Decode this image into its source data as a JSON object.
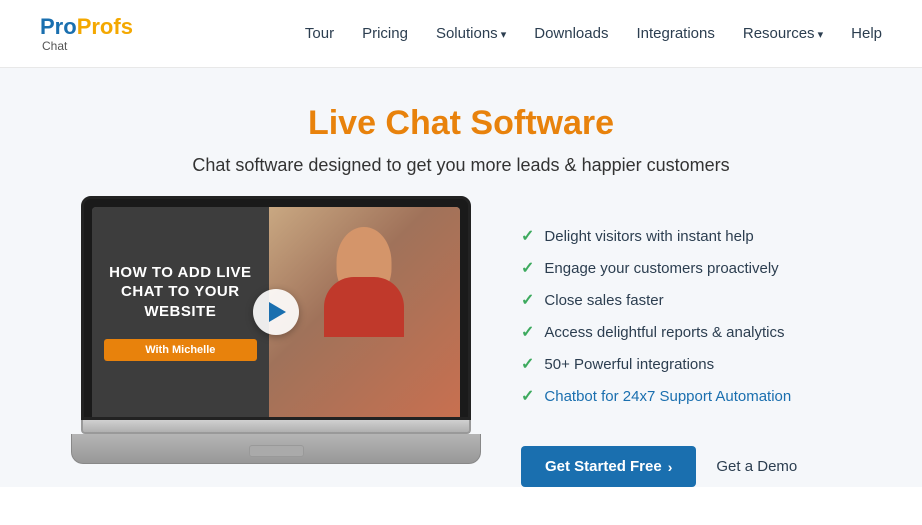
{
  "logo": {
    "pro": "Pro",
    "profs": "Profs",
    "chat": "Chat"
  },
  "nav": {
    "items": [
      {
        "label": "Tour",
        "id": "tour",
        "hasDropdown": false
      },
      {
        "label": "Pricing",
        "id": "pricing",
        "hasDropdown": false
      },
      {
        "label": "Solutions",
        "id": "solutions",
        "hasDropdown": true
      },
      {
        "label": "Downloads",
        "id": "downloads",
        "hasDropdown": false
      },
      {
        "label": "Integrations",
        "id": "integrations",
        "hasDropdown": false
      },
      {
        "label": "Resources",
        "id": "resources",
        "hasDropdown": true
      },
      {
        "label": "Help",
        "id": "help",
        "hasDropdown": false
      }
    ]
  },
  "hero": {
    "title": "Live Chat Software",
    "subtitle": "Chat software designed to get you more leads & happier customers"
  },
  "video": {
    "title": "HOW TO ADD LIVE CHAT TO YOUR WEBSITE",
    "badge": "With Michelle"
  },
  "features": [
    {
      "text": "Delight visitors with instant help",
      "highlight": false
    },
    {
      "text": "Engage your customers proactively",
      "highlight": false
    },
    {
      "text": "Close sales faster",
      "highlight": false
    },
    {
      "text": "Access delightful reports & analytics",
      "highlight": false
    },
    {
      "text": "50+ Powerful integrations",
      "highlight": false
    },
    {
      "text": "Chatbot for 24x7 Support Automation",
      "highlight": true
    }
  ],
  "cta": {
    "primary_label": "Get Started Free",
    "primary_chevron": "›",
    "secondary_label": "Get a Demo"
  }
}
